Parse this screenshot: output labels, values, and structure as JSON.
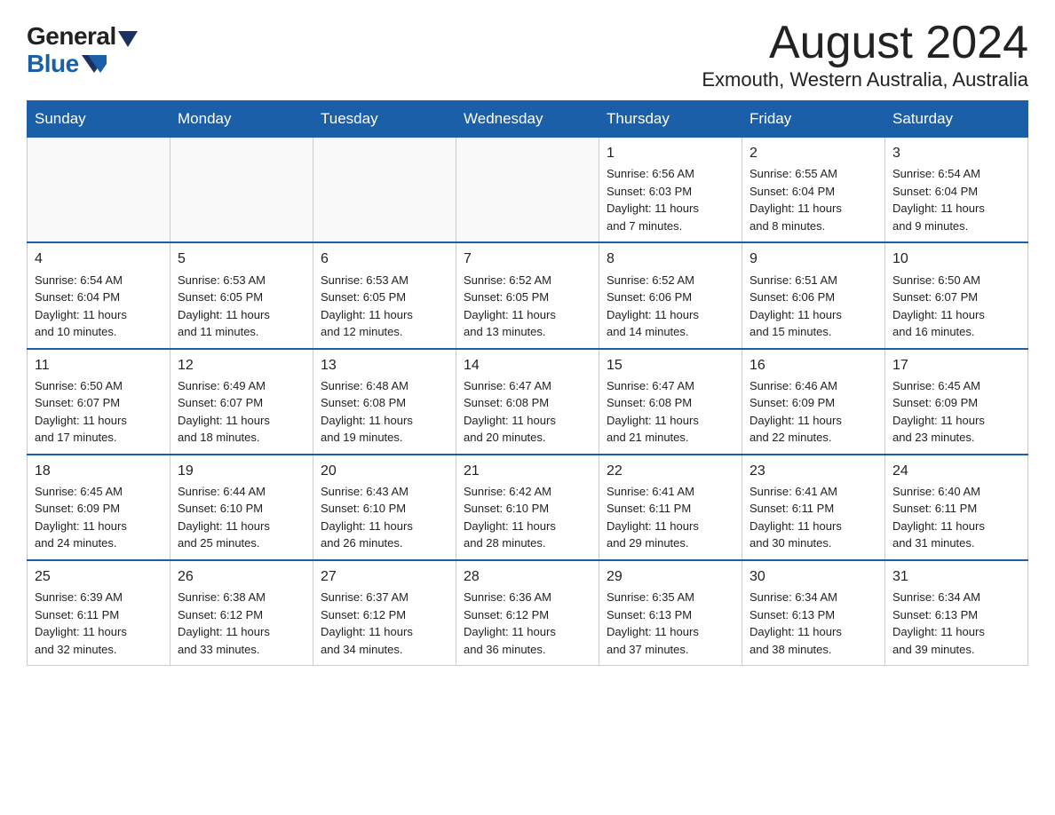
{
  "header": {
    "logo_line1": "General",
    "logo_line2": "Blue",
    "month_year": "August 2024",
    "location": "Exmouth, Western Australia, Australia"
  },
  "calendar": {
    "days_of_week": [
      "Sunday",
      "Monday",
      "Tuesday",
      "Wednesday",
      "Thursday",
      "Friday",
      "Saturday"
    ],
    "weeks": [
      [
        {
          "day": "",
          "info": ""
        },
        {
          "day": "",
          "info": ""
        },
        {
          "day": "",
          "info": ""
        },
        {
          "day": "",
          "info": ""
        },
        {
          "day": "1",
          "info": "Sunrise: 6:56 AM\nSunset: 6:03 PM\nDaylight: 11 hours\nand 7 minutes."
        },
        {
          "day": "2",
          "info": "Sunrise: 6:55 AM\nSunset: 6:04 PM\nDaylight: 11 hours\nand 8 minutes."
        },
        {
          "day": "3",
          "info": "Sunrise: 6:54 AM\nSunset: 6:04 PM\nDaylight: 11 hours\nand 9 minutes."
        }
      ],
      [
        {
          "day": "4",
          "info": "Sunrise: 6:54 AM\nSunset: 6:04 PM\nDaylight: 11 hours\nand 10 minutes."
        },
        {
          "day": "5",
          "info": "Sunrise: 6:53 AM\nSunset: 6:05 PM\nDaylight: 11 hours\nand 11 minutes."
        },
        {
          "day": "6",
          "info": "Sunrise: 6:53 AM\nSunset: 6:05 PM\nDaylight: 11 hours\nand 12 minutes."
        },
        {
          "day": "7",
          "info": "Sunrise: 6:52 AM\nSunset: 6:05 PM\nDaylight: 11 hours\nand 13 minutes."
        },
        {
          "day": "8",
          "info": "Sunrise: 6:52 AM\nSunset: 6:06 PM\nDaylight: 11 hours\nand 14 minutes."
        },
        {
          "day": "9",
          "info": "Sunrise: 6:51 AM\nSunset: 6:06 PM\nDaylight: 11 hours\nand 15 minutes."
        },
        {
          "day": "10",
          "info": "Sunrise: 6:50 AM\nSunset: 6:07 PM\nDaylight: 11 hours\nand 16 minutes."
        }
      ],
      [
        {
          "day": "11",
          "info": "Sunrise: 6:50 AM\nSunset: 6:07 PM\nDaylight: 11 hours\nand 17 minutes."
        },
        {
          "day": "12",
          "info": "Sunrise: 6:49 AM\nSunset: 6:07 PM\nDaylight: 11 hours\nand 18 minutes."
        },
        {
          "day": "13",
          "info": "Sunrise: 6:48 AM\nSunset: 6:08 PM\nDaylight: 11 hours\nand 19 minutes."
        },
        {
          "day": "14",
          "info": "Sunrise: 6:47 AM\nSunset: 6:08 PM\nDaylight: 11 hours\nand 20 minutes."
        },
        {
          "day": "15",
          "info": "Sunrise: 6:47 AM\nSunset: 6:08 PM\nDaylight: 11 hours\nand 21 minutes."
        },
        {
          "day": "16",
          "info": "Sunrise: 6:46 AM\nSunset: 6:09 PM\nDaylight: 11 hours\nand 22 minutes."
        },
        {
          "day": "17",
          "info": "Sunrise: 6:45 AM\nSunset: 6:09 PM\nDaylight: 11 hours\nand 23 minutes."
        }
      ],
      [
        {
          "day": "18",
          "info": "Sunrise: 6:45 AM\nSunset: 6:09 PM\nDaylight: 11 hours\nand 24 minutes."
        },
        {
          "day": "19",
          "info": "Sunrise: 6:44 AM\nSunset: 6:10 PM\nDaylight: 11 hours\nand 25 minutes."
        },
        {
          "day": "20",
          "info": "Sunrise: 6:43 AM\nSunset: 6:10 PM\nDaylight: 11 hours\nand 26 minutes."
        },
        {
          "day": "21",
          "info": "Sunrise: 6:42 AM\nSunset: 6:10 PM\nDaylight: 11 hours\nand 28 minutes."
        },
        {
          "day": "22",
          "info": "Sunrise: 6:41 AM\nSunset: 6:11 PM\nDaylight: 11 hours\nand 29 minutes."
        },
        {
          "day": "23",
          "info": "Sunrise: 6:41 AM\nSunset: 6:11 PM\nDaylight: 11 hours\nand 30 minutes."
        },
        {
          "day": "24",
          "info": "Sunrise: 6:40 AM\nSunset: 6:11 PM\nDaylight: 11 hours\nand 31 minutes."
        }
      ],
      [
        {
          "day": "25",
          "info": "Sunrise: 6:39 AM\nSunset: 6:11 PM\nDaylight: 11 hours\nand 32 minutes."
        },
        {
          "day": "26",
          "info": "Sunrise: 6:38 AM\nSunset: 6:12 PM\nDaylight: 11 hours\nand 33 minutes."
        },
        {
          "day": "27",
          "info": "Sunrise: 6:37 AM\nSunset: 6:12 PM\nDaylight: 11 hours\nand 34 minutes."
        },
        {
          "day": "28",
          "info": "Sunrise: 6:36 AM\nSunset: 6:12 PM\nDaylight: 11 hours\nand 36 minutes."
        },
        {
          "day": "29",
          "info": "Sunrise: 6:35 AM\nSunset: 6:13 PM\nDaylight: 11 hours\nand 37 minutes."
        },
        {
          "day": "30",
          "info": "Sunrise: 6:34 AM\nSunset: 6:13 PM\nDaylight: 11 hours\nand 38 minutes."
        },
        {
          "day": "31",
          "info": "Sunrise: 6:34 AM\nSunset: 6:13 PM\nDaylight: 11 hours\nand 39 minutes."
        }
      ]
    ]
  }
}
